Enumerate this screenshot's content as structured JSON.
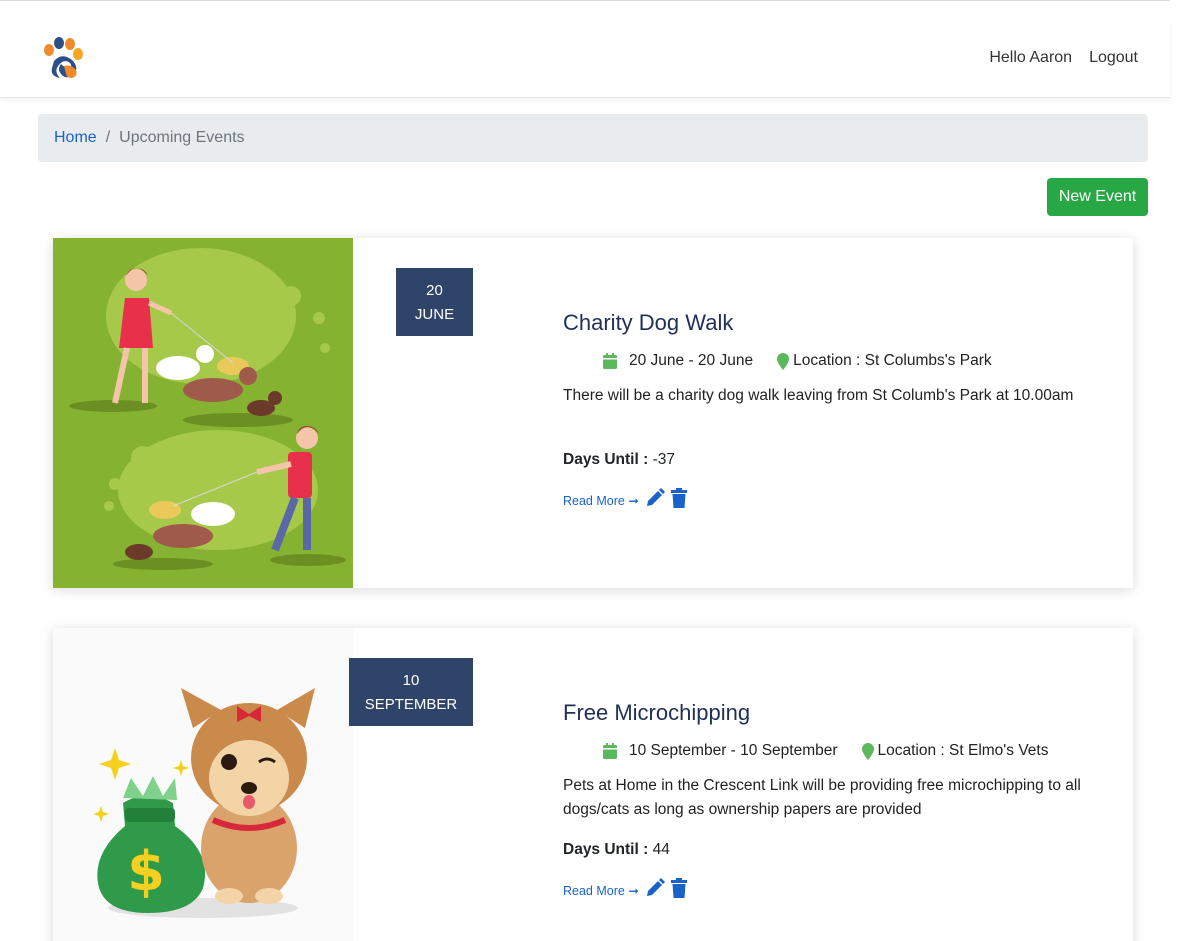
{
  "header": {
    "greeting": "Hello Aaron",
    "logout": "Logout"
  },
  "breadcrumb": {
    "home": "Home",
    "separator": "/",
    "current": "Upcoming Events"
  },
  "new_event_label": "New Event",
  "events": [
    {
      "day": "20",
      "month": "JUNE",
      "title": "Charity Dog Walk",
      "dates": "20 June - 20 June",
      "location": "Location : St Columbs's Park",
      "description": "There will be a charity dog walk leaving from St Columb's Park at 10.00am",
      "days_label": "Days Until :",
      "days_value": " -37",
      "read_more": "Read More"
    },
    {
      "day": "10",
      "month": "SEPTEMBER",
      "title": "Free Microchipping",
      "dates": "10 September - 10 September",
      "location": "Location : St Elmo's Vets",
      "description": "Pets at Home in the Crescent Link will be providing free microchipping to all dogs/cats as long as ownership papers are provided",
      "days_label": "Days Until :",
      "days_value": " 44",
      "read_more": "Read More"
    }
  ],
  "colors": {
    "accent_blue": "#1a62c9",
    "button_green": "#28a745",
    "date_box": "#2e4468",
    "icon_green": "#5cb85c"
  },
  "icons": [
    "paw-logo",
    "calendar-icon",
    "map-pin-icon",
    "arrow-right-icon",
    "pencil-icon",
    "trash-icon"
  ]
}
